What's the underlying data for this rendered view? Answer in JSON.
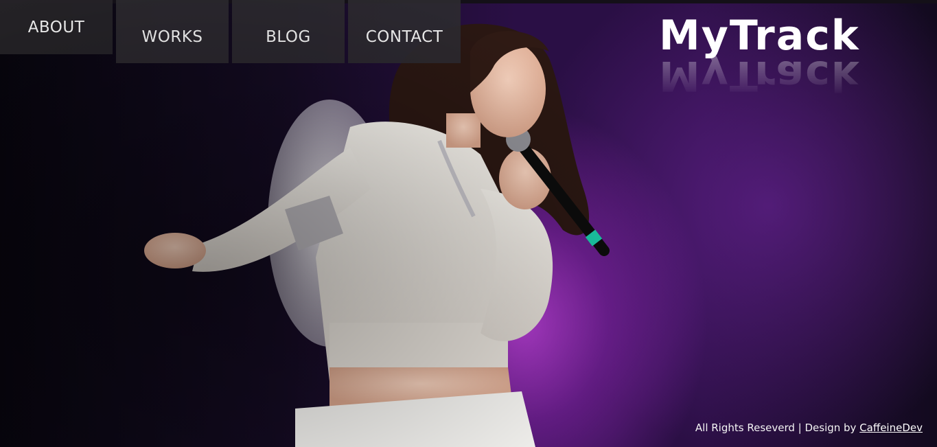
{
  "nav": {
    "items": [
      {
        "label": "ABOUT"
      },
      {
        "label": "WORKS"
      },
      {
        "label": "BLOG"
      },
      {
        "label": "CONTACT"
      }
    ]
  },
  "logo": {
    "text": "MyTrack",
    "reflection": "MyTrack"
  },
  "hero": {
    "image": "concert-performer-photo"
  },
  "footer": {
    "rights_text": "All Rights Reseverd | Design by ",
    "designer_link": "CaffeineDev"
  },
  "colors": {
    "nav_tile": "#2d2a30",
    "nav_text": "#f2f2f2",
    "stage_glow": "#c946eb",
    "background": "#0b0712"
  }
}
